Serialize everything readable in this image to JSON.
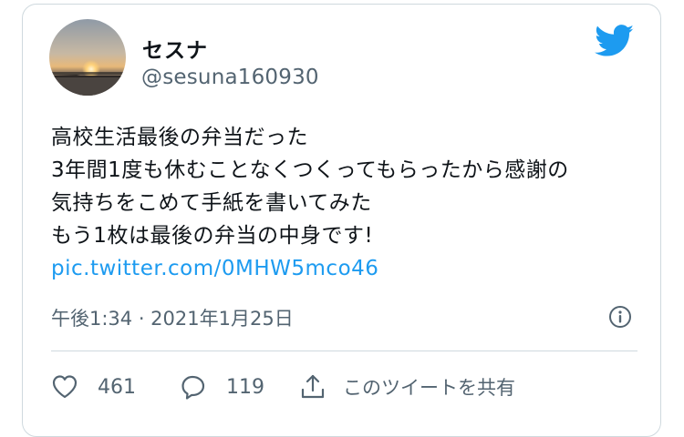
{
  "user": {
    "display_name": "セスナ",
    "handle": "@sesuna160930"
  },
  "tweet": {
    "lines": [
      "高校生活最後の弁当だった",
      "3年間1度も休むことなくつくってもらったから感謝の",
      "気持ちをこめて手紙を書いてみた",
      "もう1枚は最後の弁当の中身です!"
    ],
    "link": "pic.twitter.com/0MHW5mco46",
    "timestamp": "午後1:34 · 2021年1月25日"
  },
  "actions": {
    "likes": "461",
    "replies": "119",
    "share_label": "このツイートを共有"
  },
  "icons": {
    "brand": "twitter-bird-icon",
    "info": "info-icon",
    "like": "heart-icon",
    "reply": "speech-bubble-icon",
    "share": "share-upload-icon"
  },
  "colors": {
    "brand_blue": "#1d9bf0",
    "link_blue": "#1d9bf0",
    "secondary_text": "#536471",
    "border": "#cfd9de",
    "primary_text": "#0f1419"
  }
}
